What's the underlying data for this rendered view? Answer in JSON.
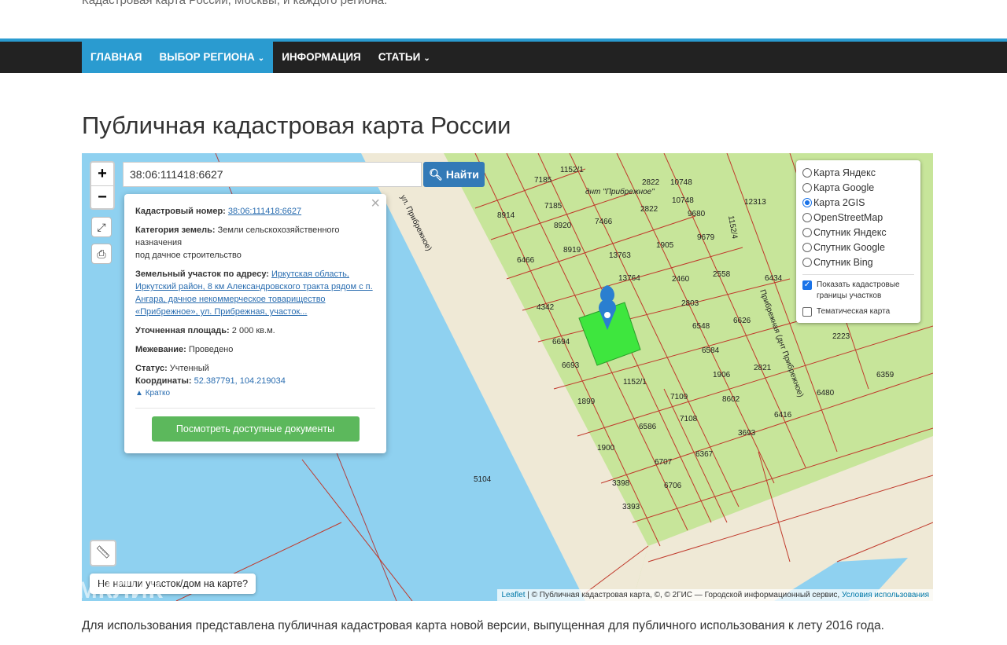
{
  "header": {
    "tagline": "Кадастровая карта России, Москвы, и каждого региона."
  },
  "nav": {
    "items": [
      {
        "label": "ГЛАВНАЯ"
      },
      {
        "label": "ВЫБОР РЕГИОНА"
      },
      {
        "label": "ИНФОРМАЦИЯ"
      },
      {
        "label": "СТАТЬИ"
      }
    ]
  },
  "page": {
    "title": "Публичная кадастровая карта России",
    "bottom_text": "Для использования представлена публичная кадастровая карта новой версии, выпущенная для публичного использования к лету 2016 года."
  },
  "map": {
    "search_value": "38:06:111418:6627",
    "find_label": "Найти",
    "zoom_in": "+",
    "zoom_out": "−",
    "not_found_label": "Не нашли участок/дом на карте?",
    "popup": {
      "cad_label": "Кадастровый номер:",
      "cad_value": "38:06:111418:6627",
      "cat_label": "Категория земель:",
      "cat_value": "Земли сельскохозяйственного назначения",
      "use_value": "под дачное строительство",
      "addr_label": "Земельный участок по адресу:",
      "addr_value": "Иркутская область, Иркутский район, 8 км Александровского тракта рядом с п. Ангара, дачное некоммерческое товарищество «Прибрежное», ул. Прибрежная, участок...",
      "area_label": "Уточненная площадь:",
      "area_value": "2 000 кв.м.",
      "survey_label": "Межевание:",
      "survey_value": "Проведено",
      "status_label": "Статус:",
      "status_value": "Учтенный",
      "coords_label": "Координаты:",
      "coords_value": "52.387791, 104.219034",
      "brief_label": "Кратко",
      "docs_button": "Посмотреть доступные документы"
    },
    "layers": {
      "options": [
        {
          "label": "Карта Яндекс",
          "selected": false
        },
        {
          "label": "Карта Google",
          "selected": false
        },
        {
          "label": "Карта 2GIS",
          "selected": true
        },
        {
          "label": "OpenStreetMap",
          "selected": false
        },
        {
          "label": "Спутник Яндекс",
          "selected": false
        },
        {
          "label": "Спутник Google",
          "selected": false
        },
        {
          "label": "Спутник Bing",
          "selected": false
        }
      ],
      "show_borders": "Показать кадастровые границы участков",
      "show_borders_checked": true,
      "thematic": "Тематическая карта",
      "thematic_checked": false
    },
    "labels": {
      "dnt": "днт \"Прибрежное\"",
      "street1": "ул. Прибрежное)",
      "street2": "Прибрежная (днт Прибрежное)",
      "parcels": [
        "7185",
        "7185",
        "8914",
        "8920",
        "7466",
        "8919",
        "6466",
        "13763",
        "13764",
        "1905",
        "2822",
        "2822",
        "10748",
        "10748",
        "9680",
        "9679",
        "12313",
        "2460",
        "2558",
        "6434",
        "2803",
        "6548",
        "6626",
        "4342",
        "6694",
        "6693",
        "6584",
        "1906",
        "2821",
        "2223",
        "1152/1",
        "1899",
        "7109",
        "7108",
        "8602",
        "6416",
        "6480",
        "6359",
        "6586",
        "3693",
        "1900",
        "6707",
        "6367",
        "3398",
        "6706",
        "3393",
        "5104",
        "1152/1",
        "1152/4"
      ]
    },
    "attribution": {
      "leaflet": "Leaflet",
      "text": "| © Публичная кадастровая карта, ©, © 2ГИС — Городской информационный сервис,",
      "terms": "Условия использования"
    }
  },
  "watermark": "ДОМКЛИК",
  "colors": {
    "nav_accent": "#2a9bd0",
    "find_button": "#337ab7",
    "docs_button": "#5cb85c",
    "land": "#c7e59a",
    "water": "#8fd1f0",
    "sand": "#efe9d6",
    "parcel_border": "#c0392b",
    "selected_parcel": "#3ee63e"
  }
}
